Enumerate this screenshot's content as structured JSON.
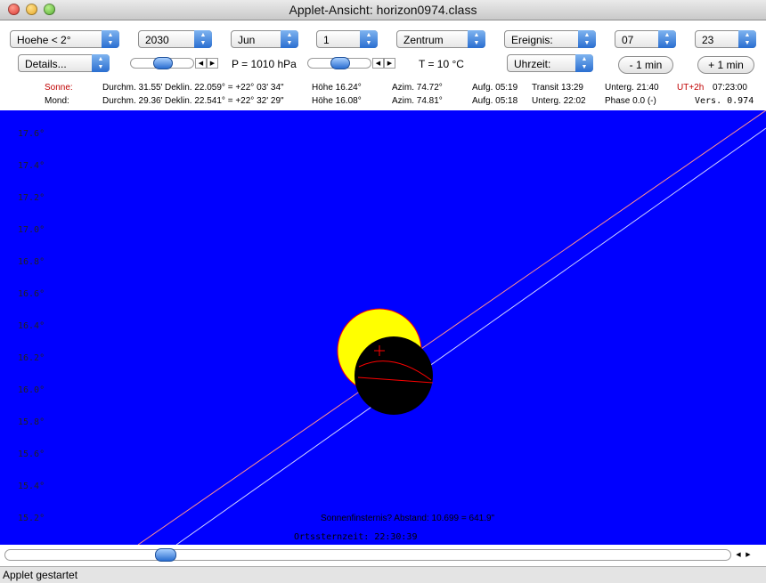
{
  "window": {
    "title": "Applet-Ansicht: horizon0974.class"
  },
  "controls": {
    "row1": [
      {
        "name": "hoehe-select",
        "value": "Hoehe < 2°"
      },
      {
        "name": "year-select",
        "value": "2030"
      },
      {
        "name": "month-select",
        "value": "Jun"
      },
      {
        "name": "day-select",
        "value": "1"
      },
      {
        "name": "mode-select",
        "value": "Zentrum"
      },
      {
        "name": "event-select",
        "value": "Ereignis:"
      },
      {
        "name": "hour-select",
        "value": "07"
      },
      {
        "name": "minute-select",
        "value": "23"
      }
    ],
    "details": "Details...",
    "pressure": "P = 1010 hPa",
    "temperature": "T = 10 °C",
    "uhrzeit": "Uhrzeit:",
    "minus_min": "- 1 min",
    "plus_min": "+ 1 min"
  },
  "sun": {
    "label": "Sonne:",
    "diameter": "Durchm. 31.55'",
    "decl": "Deklin. 22.059° = +22° 03' 34\"",
    "height": "Höhe 16.24°",
    "azimuth": "Azim. 74.72°",
    "rise": "Aufg. 05:19",
    "transit": "Transit 13:29",
    "set": "Unterg. 21:40",
    "utc": "UT+2h",
    "time": "07:23:00"
  },
  "moon": {
    "label": "Mond:",
    "diameter": "Durchm. 29.36'",
    "decl": "Deklin. 22.541° = +22° 32' 29\"",
    "height": "Höhe 16.08°",
    "azimuth": "Azim. 74.81°",
    "rise": "Aufg. 05:18",
    "set": "Unterg. 22:02",
    "phase": "Phase 0.0 (-)",
    "version": "Vers. 0.974"
  },
  "axis_labels": [
    "17.6°",
    "17.4°",
    "17.2°",
    "17.0°",
    "16.8°",
    "16.6°",
    "16.4°",
    "16.2°",
    "16.0°",
    "15.8°",
    "15.6°",
    "15.4°",
    "15.2°"
  ],
  "canvas_text": {
    "eclipse": "Sonnenfinsternis? Abstand: 10.699 = 641.9\"",
    "sidereal": "Ortssternzeit: 22:30:39"
  },
  "status": "Applet gestartet",
  "colors": {
    "sky": "#0000ff",
    "sun": "#ffff00",
    "moon": "#000000",
    "sun_path": "#ff8080",
    "moon_path": "#c8c8ff"
  }
}
